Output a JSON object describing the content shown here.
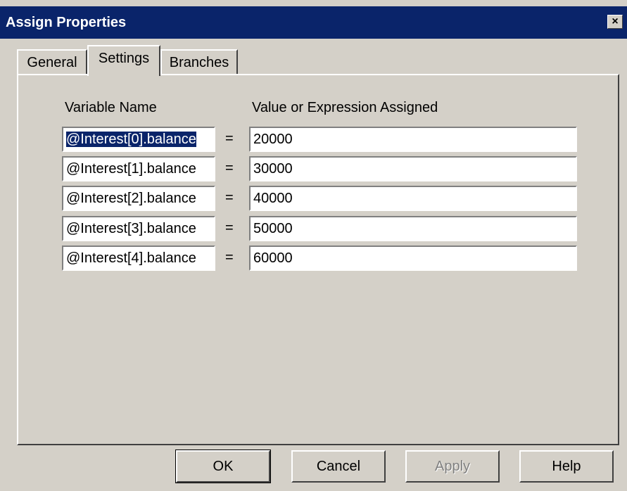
{
  "window": {
    "title": "Assign Properties",
    "close_glyph": "×"
  },
  "tabs": [
    {
      "label": "General",
      "active": false
    },
    {
      "label": "Settings",
      "active": true
    },
    {
      "label": "Branches",
      "active": false
    }
  ],
  "settings": {
    "col_variable": "Variable Name",
    "col_value": "Value or Expression Assigned",
    "rows": [
      {
        "variable": "@Interest[0].balance",
        "eq": "=",
        "value": "20000"
      },
      {
        "variable": "@Interest[1].balance",
        "eq": "=",
        "value": "30000"
      },
      {
        "variable": "@Interest[2].balance",
        "eq": "=",
        "value": "40000"
      },
      {
        "variable": "@Interest[3].balance",
        "eq": "=",
        "value": "50000"
      },
      {
        "variable": "@Interest[4].balance",
        "eq": "=",
        "value": "60000"
      }
    ]
  },
  "buttons": {
    "ok": "OK",
    "cancel": "Cancel",
    "apply": "Apply",
    "help": "Help"
  }
}
